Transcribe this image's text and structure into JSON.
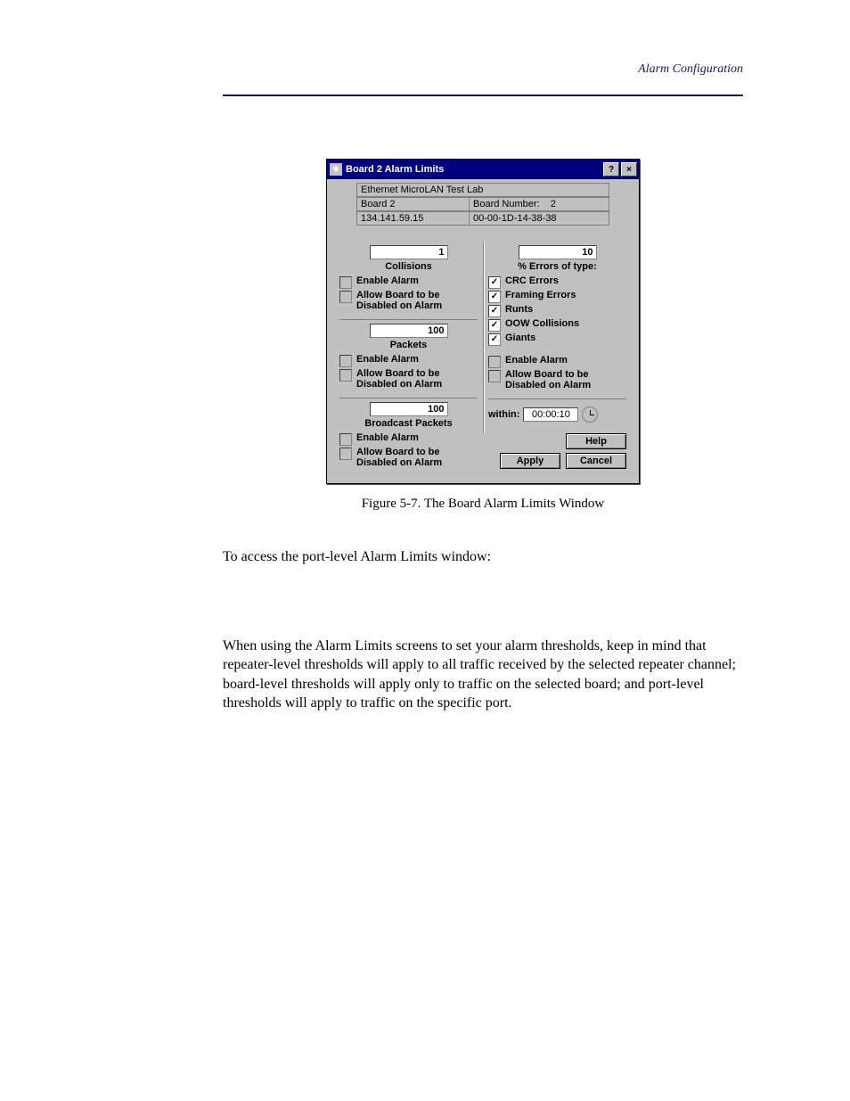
{
  "header": {
    "section": "Alarm Configuration"
  },
  "dialog": {
    "title": "Board 2 Alarm Limits",
    "help_glyph": "?",
    "close_glyph": "×",
    "app_icon": "✳",
    "info": {
      "lab": "Ethernet MicroLAN Test Lab",
      "board_left": "Board 2",
      "board_right_label": "Board Number:",
      "board_right_value": "2",
      "ip": "134.141.59.15",
      "mac": "00-00-1D-14-38-38"
    },
    "collisions": {
      "value": "1",
      "label": "Collisions",
      "enable": "Enable Alarm",
      "allow": "Allow Board to be Disabled on Alarm"
    },
    "packets": {
      "value": "100",
      "label": "Packets",
      "enable": "Enable Alarm",
      "allow": "Allow Board to be Disabled on Alarm"
    },
    "broadcast": {
      "value": "100",
      "label": "Broadcast Packets",
      "enable": "Enable Alarm",
      "allow": "Allow Board to be Disabled on Alarm"
    },
    "errors": {
      "value": "10",
      "label": "% Errors of type:",
      "crc": "CRC Errors",
      "framing": "Framing Errors",
      "runts": "Runts",
      "oow": "OOW Collisions",
      "giants": "Giants",
      "enable": "Enable Alarm",
      "allow": "Allow Board to be Disabled on Alarm"
    },
    "within": {
      "label": "within:",
      "value": "00:00:10"
    },
    "buttons": {
      "help": "Help",
      "apply": "Apply",
      "cancel": "Cancel"
    }
  },
  "caption": "Figure 5-7.  The Board Alarm Limits Window",
  "para1": "To access the port-level Alarm Limits window:",
  "para2": "When using the Alarm Limits screens to set your alarm thresholds, keep in mind that repeater-level thresholds will apply to all traffic received by the selected repeater channel; board-level thresholds will apply only to traffic on the selected board; and port-level thresholds will apply to traffic on the specific port."
}
